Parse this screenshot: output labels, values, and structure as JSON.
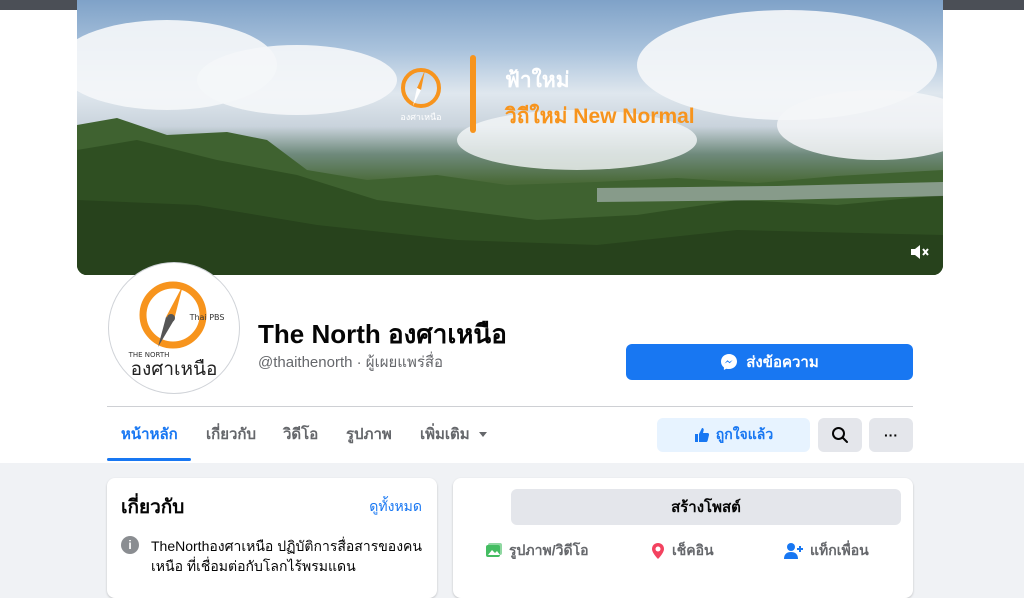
{
  "cover": {
    "brand_small": "องศาเหนือ",
    "line1": "ฟ้าใหม่",
    "line2": "วิถีใหม่ New Normal",
    "icons": {
      "mute": "speaker-mute-icon"
    }
  },
  "profile": {
    "avatar_brand_small": "THE NORTH",
    "avatar_brand_name": "องศาเหนือ",
    "avatar_partner": "Thai PBS",
    "name": "The North องศาเหนือ",
    "handle": "@thaithenorth · ผู้เผยแพร่สื่อ"
  },
  "actions": {
    "message_label": "ส่งข้อความ",
    "liked_label": "ถูกใจแล้ว",
    "more_label": "···"
  },
  "tabs": [
    {
      "label": "หน้าหลัก",
      "active": true
    },
    {
      "label": "เกี่ยวกับ",
      "active": false
    },
    {
      "label": "วิดีโอ",
      "active": false
    },
    {
      "label": "รูปภาพ",
      "active": false
    },
    {
      "label": "เพิ่มเติม",
      "active": false
    }
  ],
  "about": {
    "title": "เกี่ยวกับ",
    "see_all": "ดูทั้งหมด",
    "description": "TheNorthองศาเหนือ ปฏิบัติการสื่อสารของคนเหนือ ที่เชื่อมต่อกับโลกไร้พรมแดน"
  },
  "composer": {
    "create_post": "สร้างโพสต์",
    "photo_video": "รูปภาพ/วิดีโอ",
    "check_in": "เช็คอิน",
    "tag_friends": "แท็กเพื่อน"
  },
  "colors": {
    "accent": "#1877f2",
    "brand_orange": "#f7941d",
    "liked_bg": "#e7f3ff",
    "page_bg": "#f0f2f5"
  }
}
